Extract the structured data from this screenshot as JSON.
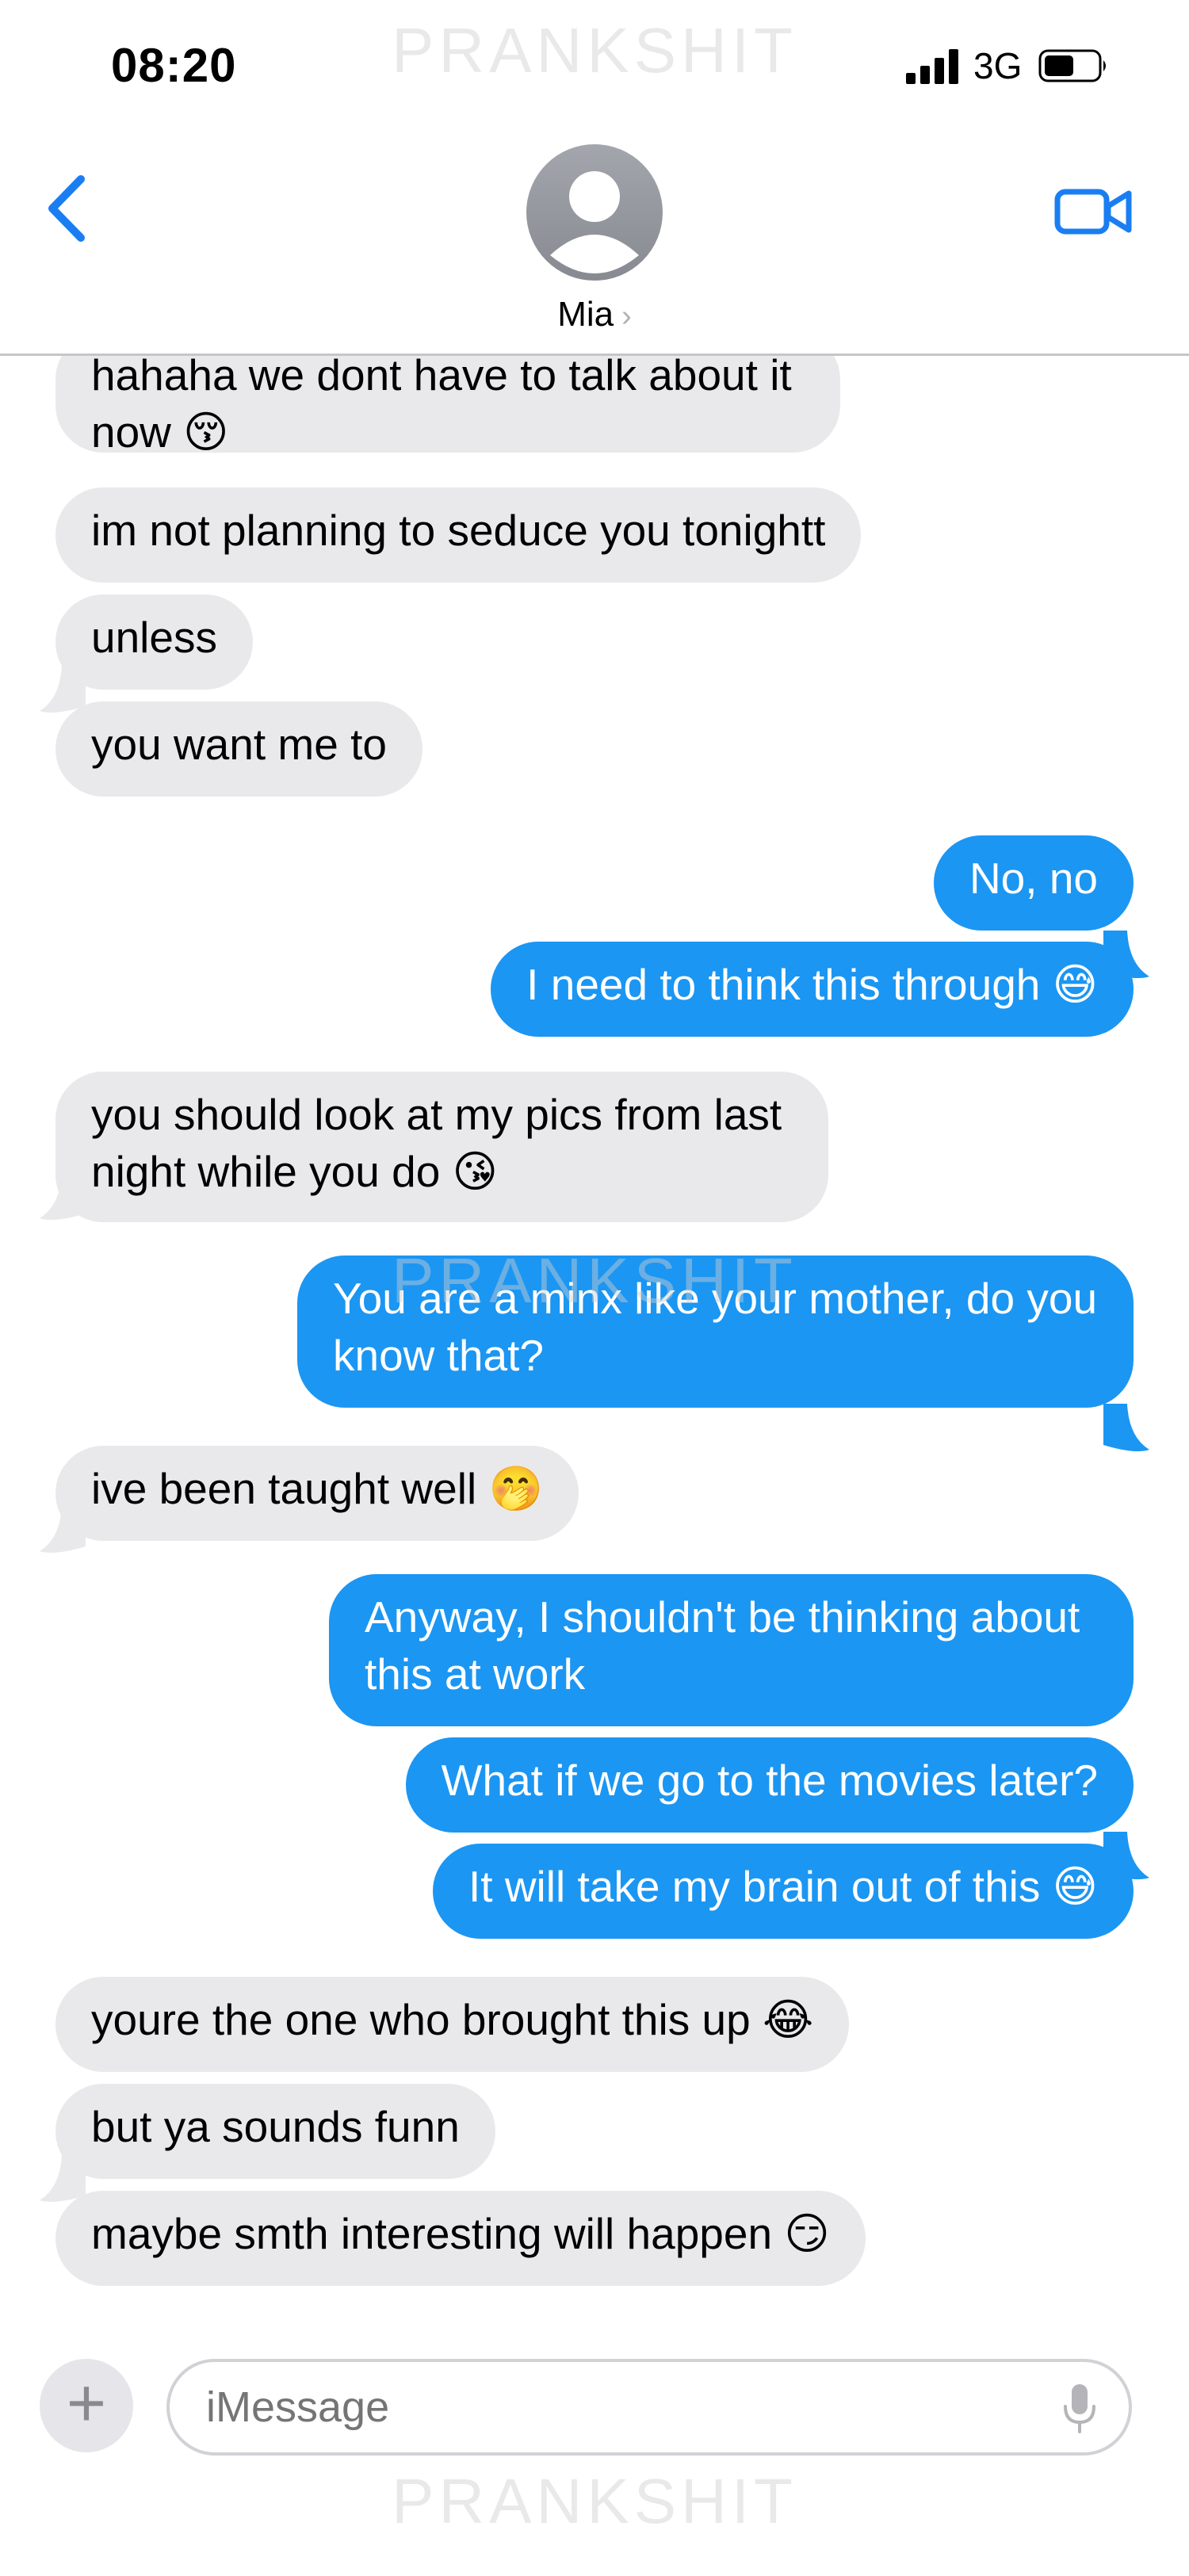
{
  "status": {
    "time": "08:20",
    "network": "3G"
  },
  "watermark": "PRANKSHIT",
  "contact": {
    "name": "Mia"
  },
  "icons": {
    "back": "chevron-left-icon",
    "video": "video-camera-icon",
    "avatar": "person-icon",
    "plus": "plus-icon",
    "mic": "microphone-icon"
  },
  "colors": {
    "accent": "#1b96f3",
    "received": "#e9e9eb",
    "ios_blue": "#1a7ef2"
  },
  "messages": [
    {
      "from": "them",
      "text": "hahaha we dont have to talk about it\nnow 😚"
    },
    {
      "from": "them",
      "text": "im not planning to seduce you tonightt"
    },
    {
      "from": "them",
      "text": "unless"
    },
    {
      "from": "them",
      "text": "you want me to"
    },
    {
      "from": "me",
      "text": "No, no"
    },
    {
      "from": "me",
      "text": "I need to think this through 😅"
    },
    {
      "from": "them",
      "text": "you should look at my pics from last\nnight while you do 😘"
    },
    {
      "from": "me",
      "text": "You are a minx like your mother, do you\nknow that?"
    },
    {
      "from": "them",
      "text": "ive been taught well 🤭"
    },
    {
      "from": "me",
      "text": "Anyway, I shouldn't be thinking about\nthis at work"
    },
    {
      "from": "me",
      "text": "What if we go to the movies later?"
    },
    {
      "from": "me",
      "text": "It will take my brain out of this 😅"
    },
    {
      "from": "them",
      "text": "youre the one who brought this up 😂"
    },
    {
      "from": "them",
      "text": "but ya sounds funn"
    },
    {
      "from": "them",
      "text": "maybe smth interesting will happen 😏"
    }
  ],
  "composer": {
    "placeholder": "iMessage"
  }
}
